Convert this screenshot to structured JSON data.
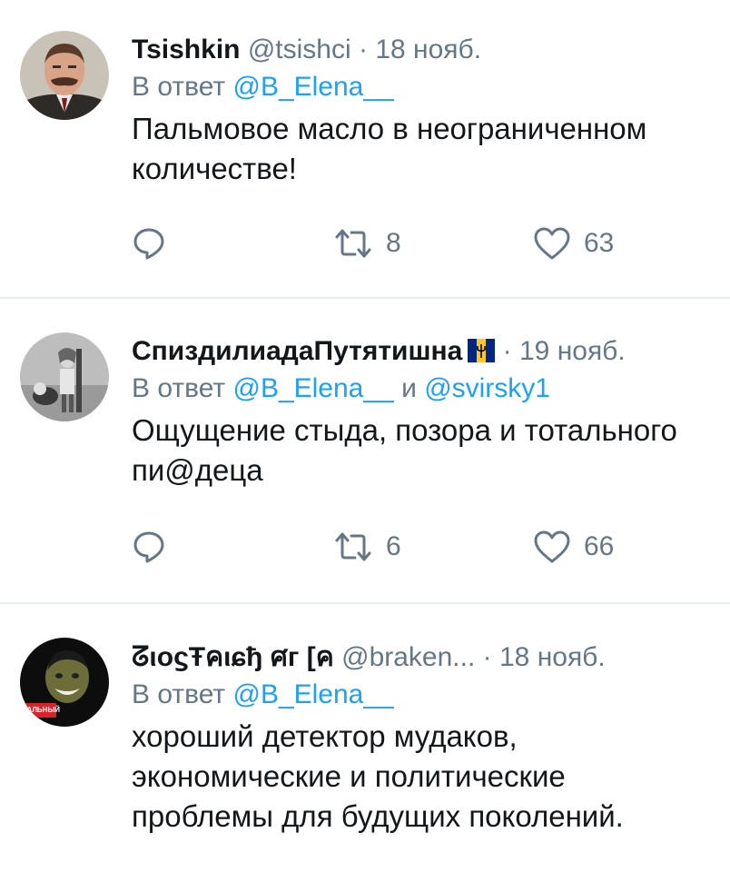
{
  "tweets": [
    {
      "name": "Tsishkin",
      "handle": "@tsishci",
      "date": "18 нояб.",
      "reply_prefix": "В ответ",
      "reply_to": "@B_Elena__",
      "reply_joiner": "",
      "reply_to2": "",
      "text": "Пальмовое масло в неограниченном количестве!",
      "replies": "",
      "retweets": "8",
      "likes": "63",
      "avatar_icon": "avatar-man-mustache"
    },
    {
      "name": "СпиздилиадаПутятишна",
      "handle": "",
      "date": "19 нояб.",
      "reply_prefix": "В ответ",
      "reply_to": "@B_Elena__",
      "reply_joiner": "и",
      "reply_to2": "@svirsky1",
      "text": "Ощущение стыда, позора и тотального пи@деца",
      "replies": "",
      "retweets": "6",
      "likes": "66",
      "avatar_icon": "avatar-girl-dog-photo",
      "flag": "barbados-flag-icon"
    },
    {
      "name": "ᘔιοϛŦคιɕђ ศг [ค",
      "handle": "@braken...",
      "date": "18 нояб.",
      "reply_prefix": "В ответ",
      "reply_to": "@B_Elena__",
      "reply_joiner": "",
      "reply_to2": "",
      "text": "хороший детектор мудаков, экономические и политические проблемы для будущих поколений.",
      "avatar_icon": "avatar-smiling-man-dark",
      "avatar_badge": "БАЛЬНЫЙ"
    }
  ],
  "colors": {
    "text": "#14171a",
    "secondary": "#657786",
    "link": "#1da1f2",
    "divider": "#e6ecf0"
  }
}
